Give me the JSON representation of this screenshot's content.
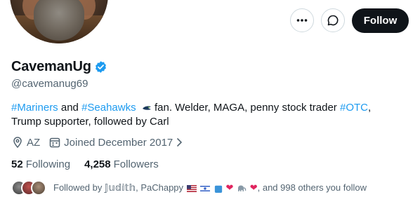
{
  "header": {
    "more_icon": "more-dots-icon",
    "message_icon": "chat-bubble-icon",
    "follow_label": "Follow"
  },
  "profile": {
    "display_name": "CavemanUg",
    "handle": "@cavemanug69",
    "verified": true,
    "accent_color": "#1d9bf0",
    "bio": {
      "tag1": "#Mariners",
      "and": " and ",
      "tag2": "#Seahawks",
      "text1": " fan. Welder,  MAGA, penny stock trader ",
      "tag3": "#OTC",
      "text2": ",",
      "line2": "Trump supporter, followed by Carl"
    },
    "location": "AZ",
    "joined": "Joined December 2017"
  },
  "stats": {
    "following_count": "52",
    "following_label": "Following",
    "followers_count": "4,258",
    "followers_label": "Followers"
  },
  "followed_by": {
    "prefix": "Followed by ",
    "name1": "𝕁𝕦𝕕𝕚𝕥𝕙",
    "sep": ", ",
    "name2": "PaChappy",
    "hearts": "❤",
    "suffix": ", and 998 others you follow"
  }
}
